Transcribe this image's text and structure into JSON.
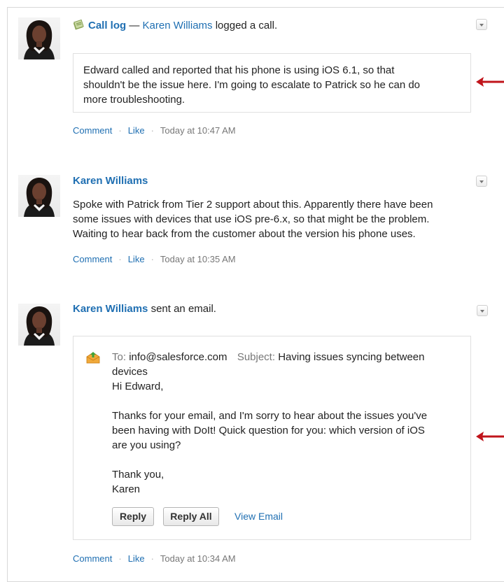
{
  "colors": {
    "link": "#1f6fb2",
    "arrow": "#c0141b",
    "border": "#e0e0e0"
  },
  "posts": [
    {
      "type_label": "Call log",
      "dash": " — ",
      "author": "Karen Williams",
      "action": " logged a call.",
      "body": [
        "Edward called and reported that his phone is using iOS 6.1, so that",
        "shouldn't be the issue here. I'm going to escalate to Patrick so he can do",
        "more troubleshooting."
      ],
      "comment": "Comment",
      "like": "Like",
      "time": "Today at 10:47 AM"
    },
    {
      "author": "Karen Williams",
      "body": [
        "Spoke with Patrick from Tier 2 support about this. Apparently there have been",
        "some issues with devices that use iOS pre-6.x, so that might be the problem.",
        "Waiting to hear back from the customer about the version his phone uses."
      ],
      "comment": "Comment",
      "like": "Like",
      "time": "Today at 10:35 AM"
    },
    {
      "author": "Karen Williams",
      "action": " sent an email.",
      "to_label": "To:",
      "to_value": "info@salesforce.com",
      "subject_label": "Subject:",
      "subject_value_1": "Having issues syncing between",
      "subject_value_2": "devices",
      "greeting": "Hi Edward,",
      "body": [
        "Thanks for your email, and I'm sorry to hear about the issues you've",
        "been having with DoIt! Quick question for you: which version of iOS",
        "are you using?"
      ],
      "signoff_1": "Thank you,",
      "signoff_2": "Karen",
      "reply": "Reply",
      "reply_all": "Reply All",
      "view_email": "View Email",
      "comment": "Comment",
      "like": "Like",
      "time": "Today at 10:34 AM"
    }
  ]
}
